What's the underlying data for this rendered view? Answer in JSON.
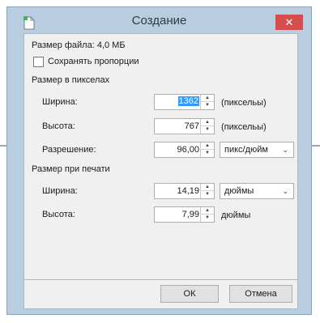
{
  "dialog": {
    "title": "Создание",
    "close_glyph": "✕",
    "file_size_label": "Размер файла: 4,0 МБ",
    "keep_proportions_label": "Сохранять пропорции",
    "keep_proportions_checked": false,
    "pixel_section_label": "Размер в пикселах",
    "pixel": {
      "width_label": "Ширина:",
      "width_value": "1362",
      "width_unit": "(пиксельы)",
      "height_label": "Высота:",
      "height_value": "767",
      "height_unit": "(пиксельы)",
      "resolution_label": "Разрешение:",
      "resolution_value": "96,00",
      "resolution_unit": "пикс/дюйм"
    },
    "print_section_label": "Размер при печати",
    "print": {
      "width_label": "Ширина:",
      "width_value": "14,19",
      "width_unit": "дюймы",
      "height_label": "Высота:",
      "height_value": "7,99",
      "height_unit": "дюймы"
    },
    "ok_label": "ОК",
    "cancel_label": "Отмена"
  },
  "icons": {
    "app": "new-document-icon",
    "close": "close-icon",
    "spin_up": "▲",
    "spin_down": "▼",
    "dropdown": "chevron-down-icon",
    "dropdown_glyph": "⌄"
  }
}
